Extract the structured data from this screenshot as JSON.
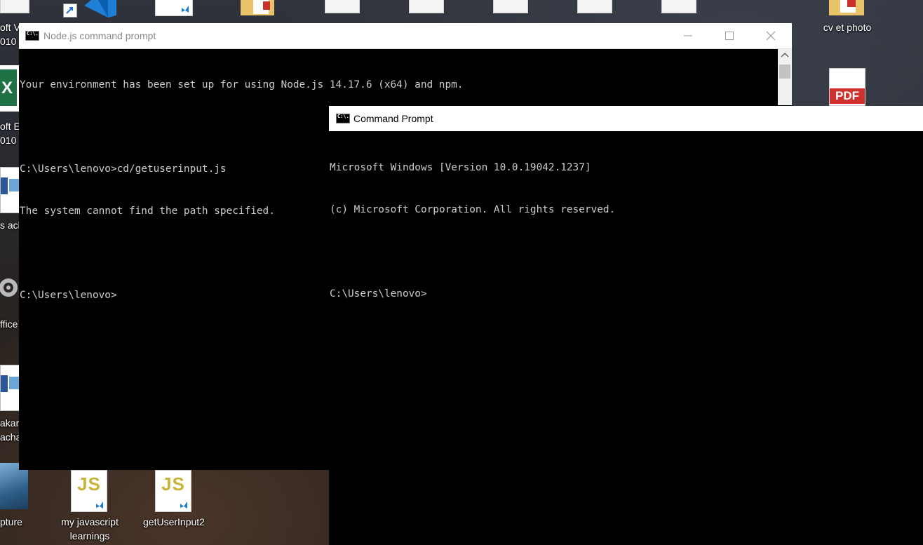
{
  "desktop": {
    "icons": [
      {
        "id": "word-2010",
        "lines": [
          "oft V",
          "010"
        ]
      },
      {
        "id": "excel-2010",
        "lines": [
          "oft E",
          "010"
        ]
      },
      {
        "id": "doc-ach",
        "lines": [
          "s ach"
        ]
      },
      {
        "id": "office-tools",
        "lines": [
          "ffice"
        ]
      },
      {
        "id": "doc-akar",
        "lines": [
          "akar",
          "acha"
        ]
      },
      {
        "id": "capture",
        "lines": [
          "pture"
        ]
      },
      {
        "id": "my-javascript-learnings",
        "lines": [
          "my javascript",
          "learnings"
        ]
      },
      {
        "id": "getuserinput2",
        "lines": [
          "getUserInput2"
        ]
      },
      {
        "id": "cv-et-photo",
        "lines": [
          "cv et photo"
        ]
      }
    ],
    "js_badge": "JS",
    "pdf_badge": "PDF"
  },
  "node_window": {
    "title": "Node.js command prompt",
    "lines": [
      "Your environment has been set up for using Node.js 14.17.6 (x64) and npm.",
      "",
      "C:\\Users\\lenovo>cd/getuserinput.js",
      "The system cannot find the path specified.",
      "",
      "C:\\Users\\lenovo>"
    ]
  },
  "cmd_window": {
    "title": "Command Prompt",
    "lines": [
      "Microsoft Windows [Version 10.0.19042.1237]",
      "(c) Microsoft Corporation. All rights reserved.",
      "",
      "C:\\Users\\lenovo>"
    ]
  }
}
